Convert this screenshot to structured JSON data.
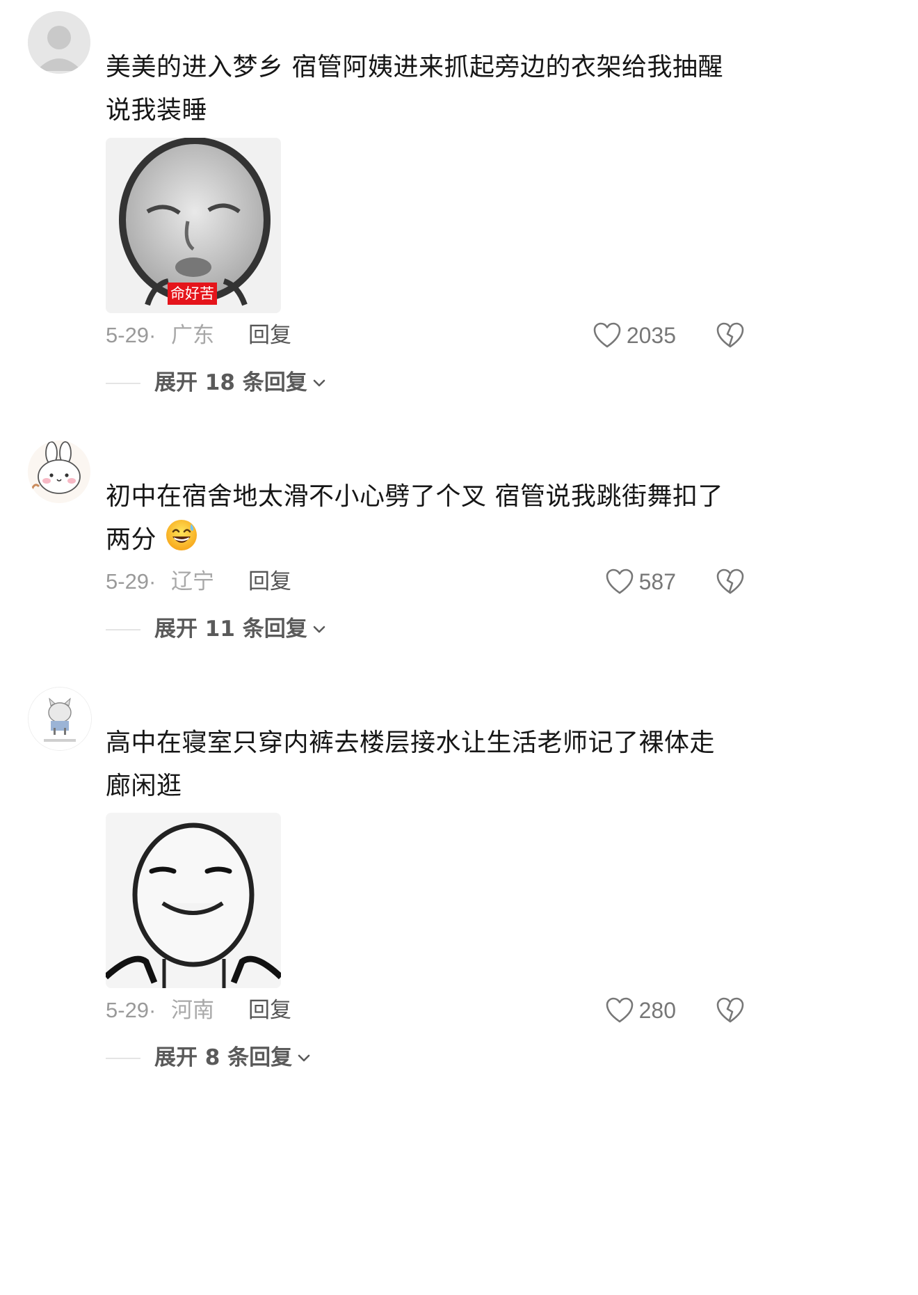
{
  "comments": [
    {
      "text": "美美的进入梦乡 宿管阿姨进来抓起旁边的衣架给我抽醒说我装睡",
      "text_lines": [
        "美美的进入梦乡 宿管阿姨进来抓起旁边的衣架给我抽醒",
        "说我装睡"
      ],
      "sticker_caption": "命好苦",
      "date": "5-29",
      "sep": "·",
      "region": "广东",
      "reply_label": "回复",
      "likes": "2035",
      "expand_label": "展开 18 条回复"
    },
    {
      "text_lines": [
        "初中在宿舍地太滑不小心劈了个叉 宿管说我跳街舞扣了",
        "两分"
      ],
      "emoji": "grinning-sweat-emoji",
      "date": "5-29",
      "sep": "·",
      "region": "辽宁",
      "reply_label": "回复",
      "likes": "587",
      "expand_label": "展开 11 条回复"
    },
    {
      "text_lines": [
        "高中在寝室只穿内裤去楼层接水让生活老师记了裸体走",
        "廊闲逛"
      ],
      "date": "5-29",
      "sep": "·",
      "region": "河南",
      "reply_label": "回复",
      "likes": "280",
      "expand_label": "展开 8 条回复"
    }
  ],
  "colors": {
    "reaction_grey": "#777777",
    "meta_grey": "#9a9a9a",
    "sticker_tag_red": "#e5141b"
  },
  "icons": {
    "like": "heart-outline-icon",
    "dislike": "broken-heart-icon",
    "expand": "chevron-down-icon"
  }
}
